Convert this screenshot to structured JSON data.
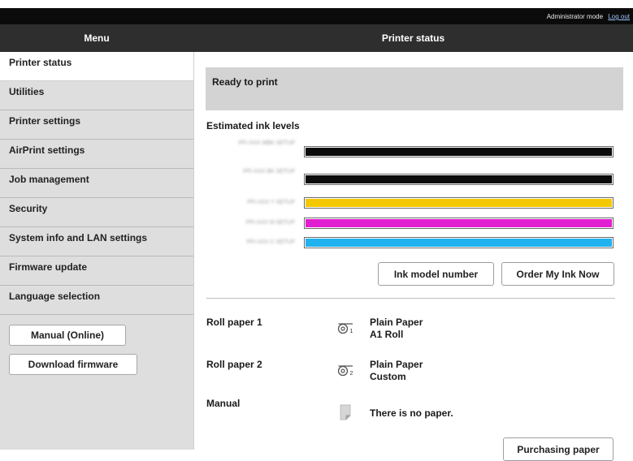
{
  "topbar": {
    "mode": "Administrator mode",
    "logout": "Log out"
  },
  "header": {
    "menu_title": "Menu",
    "page_title": "Printer status"
  },
  "sidebar": {
    "items": [
      {
        "label": "Printer status"
      },
      {
        "label": "Utilities"
      },
      {
        "label": "Printer settings"
      },
      {
        "label": "AirPrint settings"
      },
      {
        "label": "Job management"
      },
      {
        "label": "Security"
      },
      {
        "label": "System info and LAN settings"
      },
      {
        "label": "Firmware update"
      },
      {
        "label": "Language selection"
      }
    ],
    "manual_button": "Manual (Online)",
    "download_button": "Download firmware"
  },
  "main": {
    "status_text": "Ready to print",
    "ink_title": "Estimated ink levels",
    "inks": [
      {
        "label": "PFI-XXX MBK SETUP",
        "color": "#0c0c0c",
        "level": 1.0
      },
      {
        "label": "PFI-XXX BK SETUP",
        "color": "#0c0c0c",
        "level": 1.0
      },
      {
        "label": "PFI-XXX Y SETUP",
        "color": "#f4c800",
        "level": 1.0
      },
      {
        "label": "PFI-XXX M SETUP",
        "color": "#e21fd0",
        "level": 1.0
      },
      {
        "label": "PFI-XXX C SETUP",
        "color": "#1fb2ef",
        "level": 1.0
      }
    ],
    "ink_model_button": "Ink model number",
    "order_ink_button": "Order My Ink Now",
    "paper": {
      "roll1": {
        "label": "Roll paper 1",
        "icon_number": "1",
        "line1": "Plain Paper",
        "line2": "A1 Roll"
      },
      "roll2": {
        "label": "Roll paper 2",
        "icon_number": "2",
        "line1": "Plain Paper",
        "line2": "Custom"
      },
      "manual": {
        "label": "Manual",
        "text": "There is no paper."
      }
    },
    "purchasing_button": "Purchasing paper"
  }
}
